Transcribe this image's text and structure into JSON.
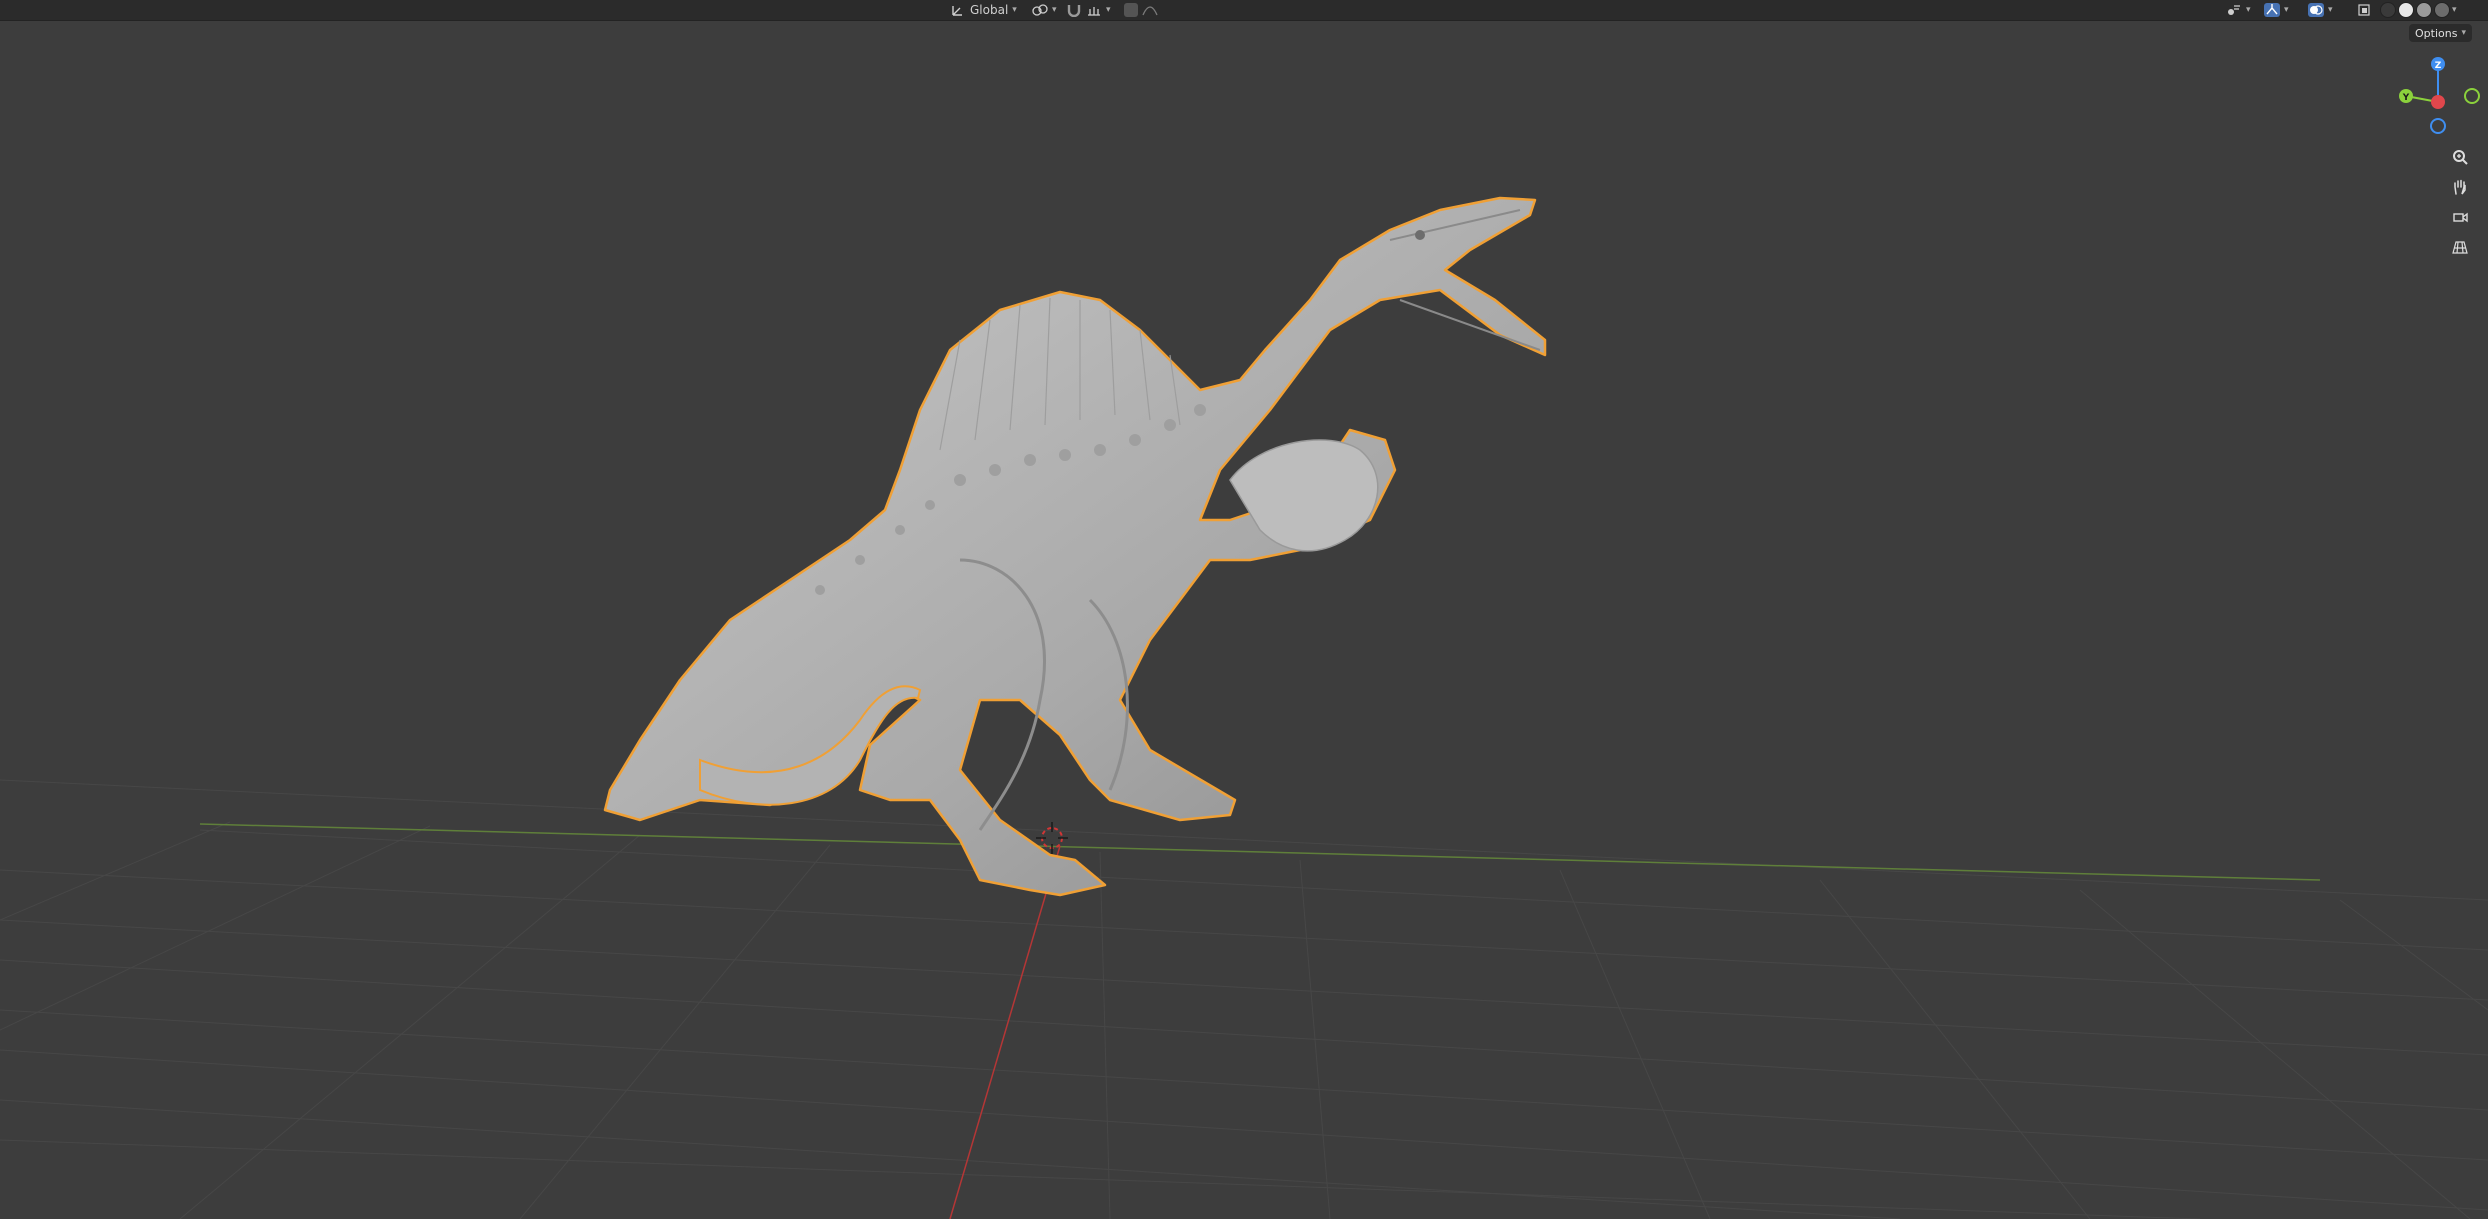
{
  "header": {
    "orientation_label": "Global",
    "orientation_icon": "transform-orientation-icon",
    "pivot_icon": "pivot-point-icon",
    "snap_icon": "magnet-snap-icon",
    "snap_increment_icon": "snap-increment-icon",
    "proportional_icon": "proportional-edit-icon",
    "falloff_icon": "falloff-curve-icon",
    "visibility_icon": "object-visibility-icon",
    "gizmo_icon": "gizmo-toggle-icon",
    "overlay_icon": "overlay-toggle-icon",
    "xray_icon": "xray-toggle-icon",
    "shading_modes": [
      "wireframe",
      "solid",
      "material",
      "rendered"
    ],
    "active_shading": "solid"
  },
  "options": {
    "label": "Options"
  },
  "gizmo": {
    "z_label": "Z",
    "y_label": "Y",
    "colors": {
      "x": "#e0474c",
      "y": "#8bd13c",
      "z": "#3f8ef0"
    }
  },
  "nav_tools": [
    {
      "name": "zoom-icon"
    },
    {
      "name": "pan-hand-icon"
    },
    {
      "name": "camera-view-icon"
    },
    {
      "name": "perspective-grid-icon"
    }
  ],
  "viewport": {
    "object_name": "spinosaurus-model",
    "selection_outline_color": "#f0a035",
    "mesh_color": "#bdbdbd",
    "grid_color": "#4a4a4a",
    "x_axis_color": "#c93b3b",
    "y_axis_color": "#6a8f3b"
  }
}
